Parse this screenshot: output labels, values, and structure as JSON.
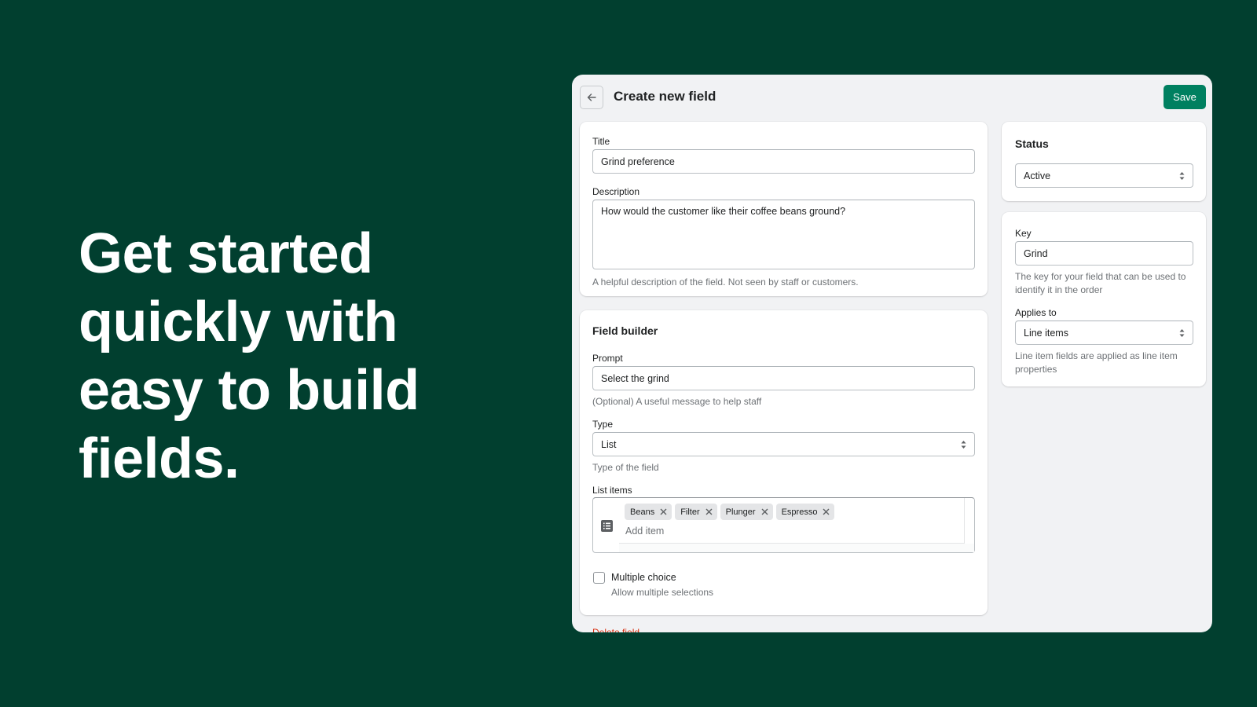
{
  "hero": {
    "line1": "Get started",
    "line2": "quickly with",
    "line3": "easy to build",
    "line4": "fields."
  },
  "header": {
    "back_icon": "arrow-left-icon",
    "title": "Create new field",
    "save_label": "Save"
  },
  "details": {
    "title_label": "Title",
    "title_value": "Grind preference",
    "description_label": "Description",
    "description_value": "How would the customer like their coffee beans ground?",
    "description_help": "A helpful description of the field. Not seen by staff or customers."
  },
  "field_builder": {
    "heading": "Field builder",
    "prompt_label": "Prompt",
    "prompt_value": "Select the grind",
    "prompt_help": "(Optional) A useful message to help staff",
    "type_label": "Type",
    "type_value": "List",
    "type_help": "Type of the field",
    "list_items_label": "List items",
    "list_icon": "list-icon",
    "list_items": [
      "Beans",
      "Filter",
      "Plunger",
      "Espresso"
    ],
    "add_item_placeholder": "Add item",
    "multiple_choice_label": "Multiple choice",
    "multiple_choice_checked": false,
    "multiple_choice_help": "Allow multiple selections"
  },
  "delete_label": "Delete field",
  "status": {
    "heading": "Status",
    "value": "Active"
  },
  "key_card": {
    "key_label": "Key",
    "key_value": "Grind",
    "key_help": "The key for your field that can be used to identify it in the order",
    "applies_label": "Applies to",
    "applies_value": "Line items",
    "applies_help": "Line item fields are applied as line item properties"
  },
  "colors": {
    "background": "#013f2f",
    "accent": "#008060",
    "danger": "#d72c0d",
    "panel": "#f1f2f4"
  }
}
